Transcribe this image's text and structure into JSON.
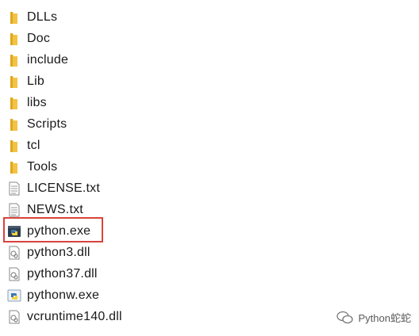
{
  "files": [
    {
      "name": "DLLs",
      "type": "folder"
    },
    {
      "name": "Doc",
      "type": "folder"
    },
    {
      "name": "include",
      "type": "folder"
    },
    {
      "name": "Lib",
      "type": "folder"
    },
    {
      "name": "libs",
      "type": "folder"
    },
    {
      "name": "Scripts",
      "type": "folder"
    },
    {
      "name": "tcl",
      "type": "folder"
    },
    {
      "name": "Tools",
      "type": "folder"
    },
    {
      "name": "LICENSE.txt",
      "type": "text"
    },
    {
      "name": "NEWS.txt",
      "type": "text"
    },
    {
      "name": "python.exe",
      "type": "python-exe"
    },
    {
      "name": "python3.dll",
      "type": "dll"
    },
    {
      "name": "python37.dll",
      "type": "dll"
    },
    {
      "name": "pythonw.exe",
      "type": "pythonw-exe"
    },
    {
      "name": "vcruntime140.dll",
      "type": "dll"
    }
  ],
  "highlighted_file": "python.exe",
  "highlight_color": "#d9433b",
  "folder_color": "#f3c346",
  "watermark": {
    "text": "Python蛇蛇",
    "icon": "wechat-icon"
  }
}
